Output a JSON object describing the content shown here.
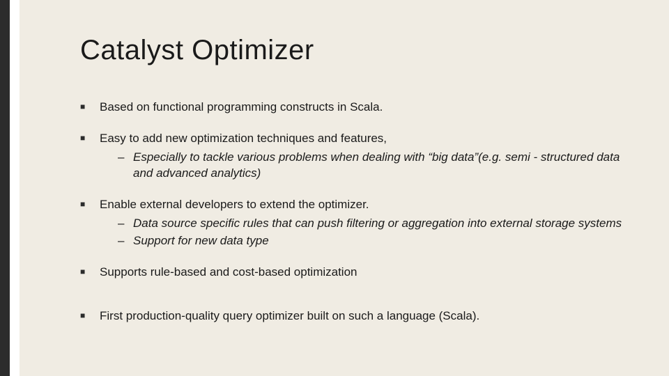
{
  "title": "Catalyst Optimizer",
  "bullets": [
    {
      "text": "Based on functional programming constructs in Scala.",
      "sub": []
    },
    {
      "text": "Easy to add new optimization techniques and features,",
      "sub": [
        "Especially to tackle various problems when dealing with “big data”(e.g. semi - structured data and advanced analytics)"
      ]
    },
    {
      "text": "Enable external developers to extend the optimizer.",
      "sub": [
        "Data source specific rules that can push filtering or aggregation into external storage systems",
        "Support for new data type"
      ]
    },
    {
      "text": "Supports rule-based and cost-based optimization",
      "sub": []
    },
    {
      "text": "First production-quality query optimizer built on such a language (Scala).",
      "sub": []
    }
  ]
}
